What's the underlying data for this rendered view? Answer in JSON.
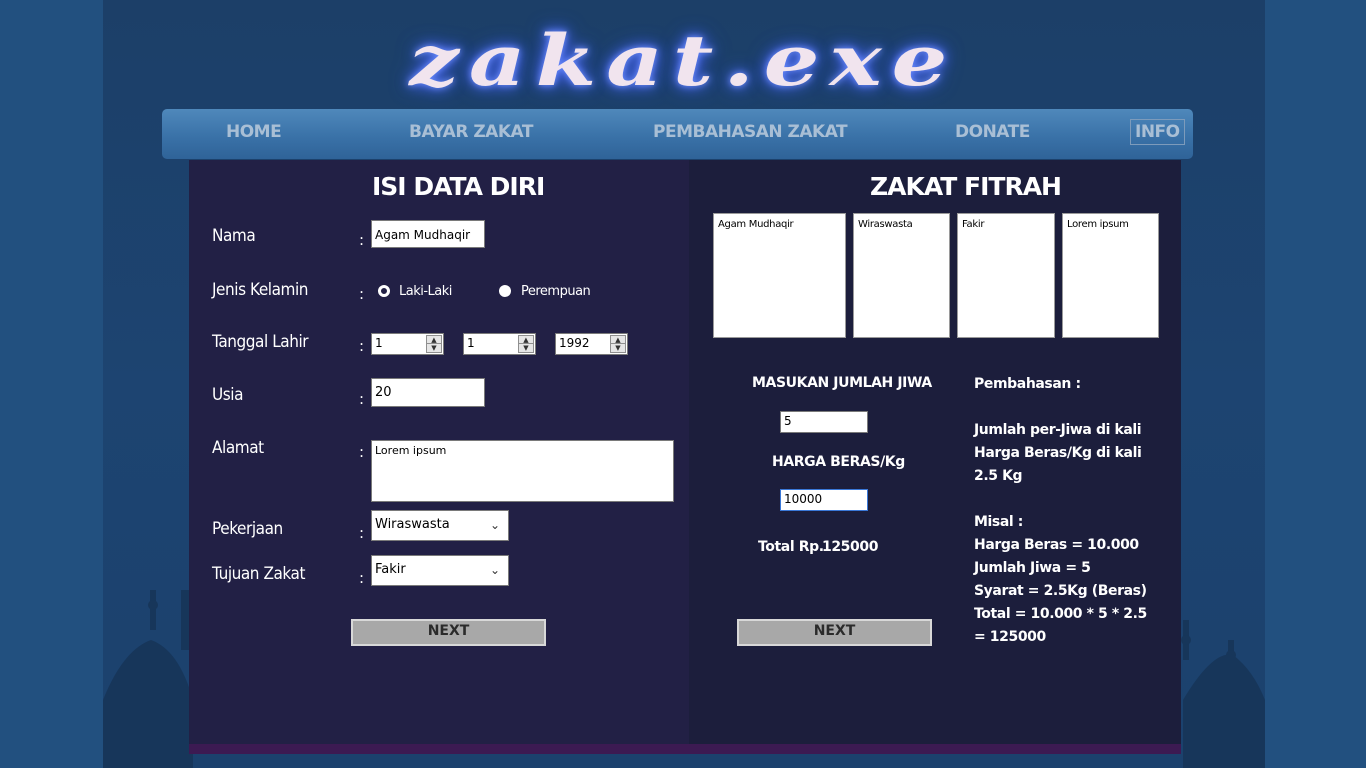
{
  "logo": {
    "text": "zakat.exe"
  },
  "nav": {
    "items": [
      "HOME",
      "BAYAR ZAKAT",
      "PEMBAHASAN ZAKAT",
      "DONATE",
      "INFO"
    ]
  },
  "left_panel": {
    "title": "ISI DATA DIRI",
    "colon": ":",
    "nama": {
      "label": "Nama",
      "value": "Agam Mudhaqir"
    },
    "jenis_kelamin": {
      "label": "Jenis Kelamin",
      "option1": "Laki-Laki",
      "option2": "Perempuan",
      "selected": "Laki-Laki"
    },
    "tanggal_lahir": {
      "label": "Tanggal Lahir",
      "day": "1",
      "month": "1",
      "year": "1992"
    },
    "usia": {
      "label": "Usia",
      "value": "20"
    },
    "alamat": {
      "label": "Alamat",
      "value": "Lorem ipsum"
    },
    "pekerjaan": {
      "label": "Pekerjaan",
      "value": "Wiraswasta"
    },
    "tujuan_zakat": {
      "label": "Tujuan Zakat",
      "value": "Fakir"
    },
    "next_label": "NEXT"
  },
  "right_panel": {
    "title": "ZAKAT FITRAH",
    "summary": [
      "Agam Mudhaqir",
      "Wiraswasta",
      "Fakir",
      "Lorem ipsum"
    ],
    "jumlah_jiwa_label": "MASUKAN JUMLAH JIWA",
    "jumlah_jiwa_value": "5",
    "harga_beras_label": "HARGA BERAS/Kg",
    "harga_beras_value": "10000",
    "total_label": "Total Rp.",
    "total_value": "125000",
    "next_label": "NEXT",
    "explanation": {
      "heading": "Pembahasan :",
      "lines1": [
        "Jumlah per-Jiwa di kali",
        "Harga Beras/Kg di kali",
        "2.5 Kg"
      ],
      "lines2": [
        "Misal :",
        "Harga Beras = 10.000",
        "Jumlah Jiwa = 5",
        "Syarat = 2.5Kg (Beras)",
        "Total = 10.000 * 5 * 2.5",
        "= 125000"
      ]
    }
  }
}
